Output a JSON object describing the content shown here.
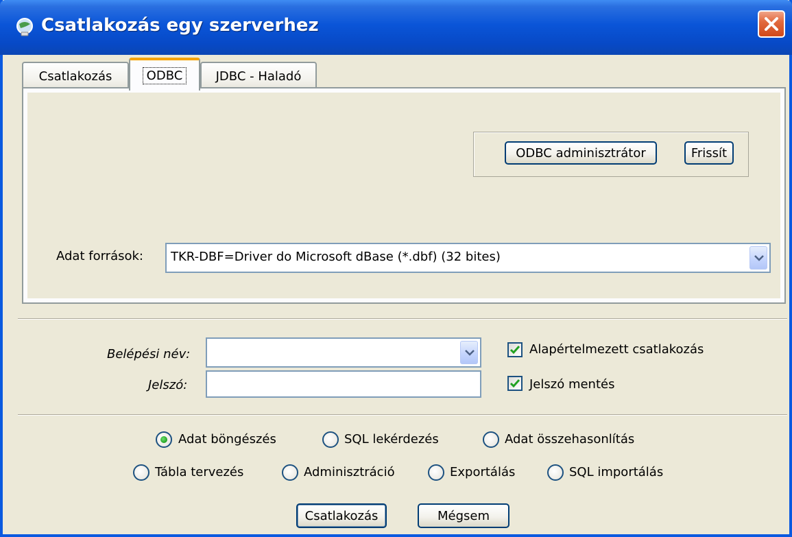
{
  "window": {
    "title": "Csatlakozás egy szerverhez"
  },
  "tabs": [
    {
      "label": "Csatlakozás",
      "active": false
    },
    {
      "label": "ODBC",
      "active": true
    },
    {
      "label": "JDBC - Haladó",
      "active": false
    }
  ],
  "odbc": {
    "admin_button": "ODBC adminisztrátor",
    "refresh_button": "Frissít",
    "datasources_label": "Adat források:",
    "datasource_value": "TKR-DBF=Driver do Microsoft dBase (*.dbf) (32 bites)"
  },
  "login": {
    "username_label": "Belépési név:",
    "username_value": "",
    "password_label": "Jelszó:",
    "password_value": "",
    "default_connect_label": "Alapértelmezett csatlakozás",
    "default_connect_checked": true,
    "save_password_label": "Jelszó mentés",
    "save_password_checked": true
  },
  "modes": [
    {
      "label": "Adat böngészés",
      "selected": true
    },
    {
      "label": "SQL lekérdezés",
      "selected": false
    },
    {
      "label": "Adat összehasonlítás",
      "selected": false
    },
    {
      "label": "Tábla tervezés",
      "selected": false
    },
    {
      "label": "Adminisztráció",
      "selected": false
    },
    {
      "label": "Exportálás",
      "selected": false
    },
    {
      "label": "SQL importálás",
      "selected": false
    }
  ],
  "actions": {
    "connect_label": "Csatlakozás",
    "cancel_label": "Mégsem"
  },
  "colors": {
    "titlebar": "#0a55d8",
    "dialog_bg": "#ece9d8",
    "active_tab_accent": "#f6a300",
    "close_button": "#d0491a"
  }
}
